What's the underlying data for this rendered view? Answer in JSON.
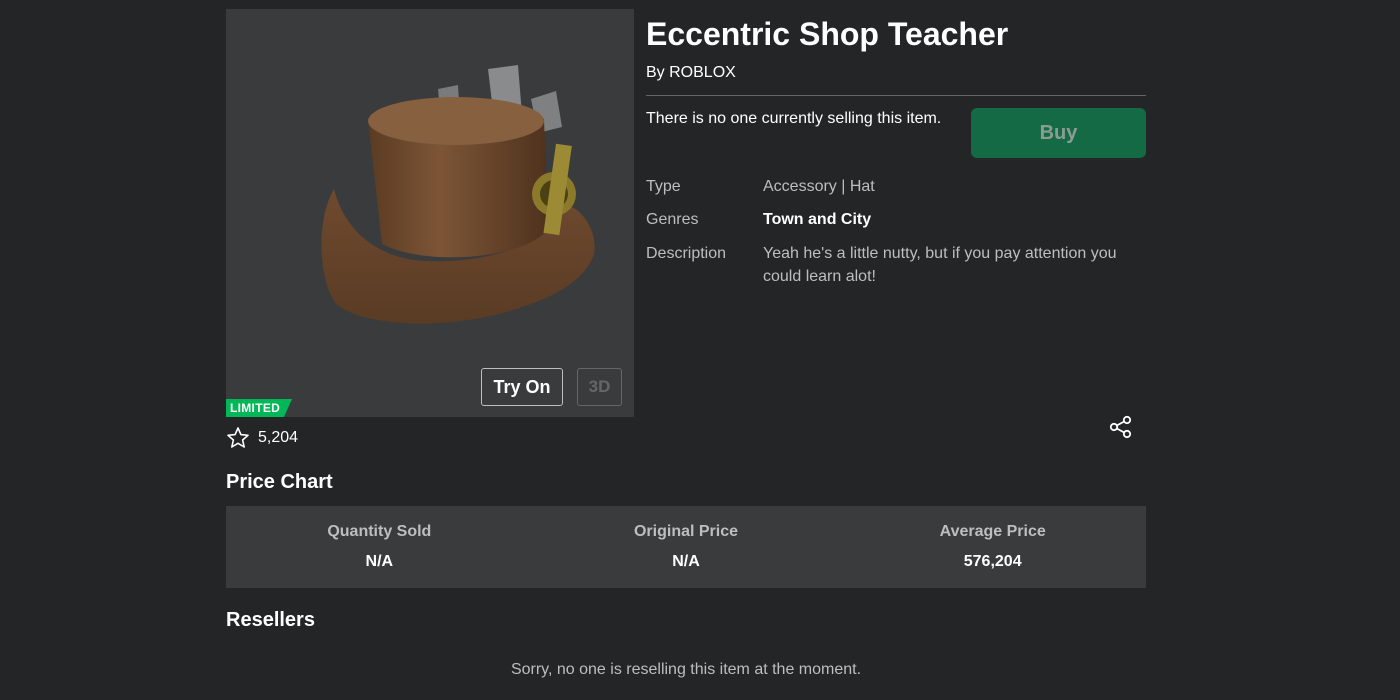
{
  "item": {
    "title": "Eccentric Shop Teacher",
    "by_label": "By",
    "creator": "ROBLOX",
    "limited_badge": "LIMITED",
    "favorites": "5,204",
    "no_sellers_text": "There is no one currently selling this item.",
    "buy_label": "Buy"
  },
  "thumbnail": {
    "try_on_label": "Try On",
    "view_3d_label": "3D"
  },
  "details": {
    "type_label": "Type",
    "type_value": "Accessory | Hat",
    "genres_label": "Genres",
    "genres_value": "Town and City",
    "description_label": "Description",
    "description_value": "Yeah he's a little nutty, but if you pay attention you could learn alot!"
  },
  "price_chart": {
    "title": "Price Chart",
    "columns": [
      {
        "label": "Quantity Sold",
        "value": "N/A"
      },
      {
        "label": "Original Price",
        "value": "N/A"
      },
      {
        "label": "Average Price",
        "value": "576,204"
      }
    ]
  },
  "resellers": {
    "title": "Resellers",
    "empty_text": "Sorry, no one is reselling this item at the moment."
  },
  "colors": {
    "background": "#232527",
    "panel": "#393b3d",
    "buy_button": "#146a45",
    "limited_badge": "#02b757"
  },
  "icons": [
    "star-icon",
    "share-icon"
  ]
}
